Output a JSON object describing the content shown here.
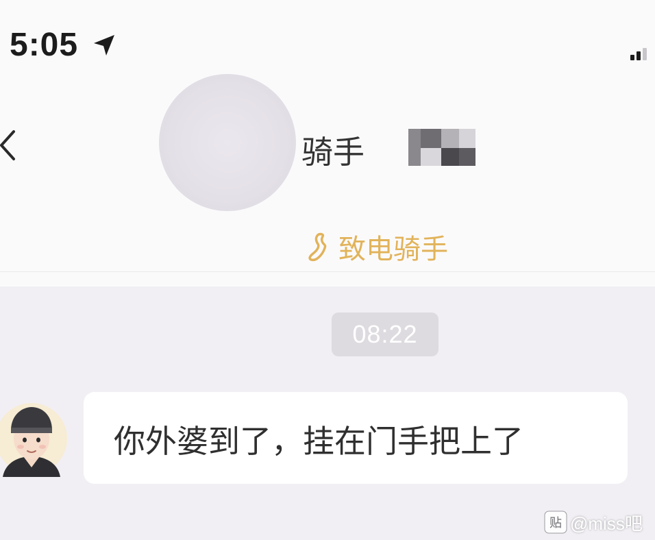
{
  "status_bar": {
    "time": "5:05",
    "location_icon": "location-arrow-icon",
    "signal_icon": "cellular-signal-icon"
  },
  "header": {
    "back_icon": "chevron-left-icon",
    "avatar": "blurred-avatar",
    "rider_name": "骑手",
    "call_icon": "phone-icon",
    "call_label": "致电骑手"
  },
  "chat": {
    "timestamp": "08:22",
    "messages": [
      {
        "sender": "rider",
        "avatar_icon": "rider-helmet-avatar-icon",
        "text": "你外婆到了，挂在门手把上了"
      }
    ]
  },
  "watermark": {
    "logo": "tieba-logo-icon",
    "text": "@miss吧"
  },
  "colors": {
    "call_accent": "#e1b35a",
    "page_background": "#f1eff3",
    "header_background": "#fbfafb",
    "bubble_background": "#ffffff",
    "timestamp_pill": "#dedbe0"
  }
}
